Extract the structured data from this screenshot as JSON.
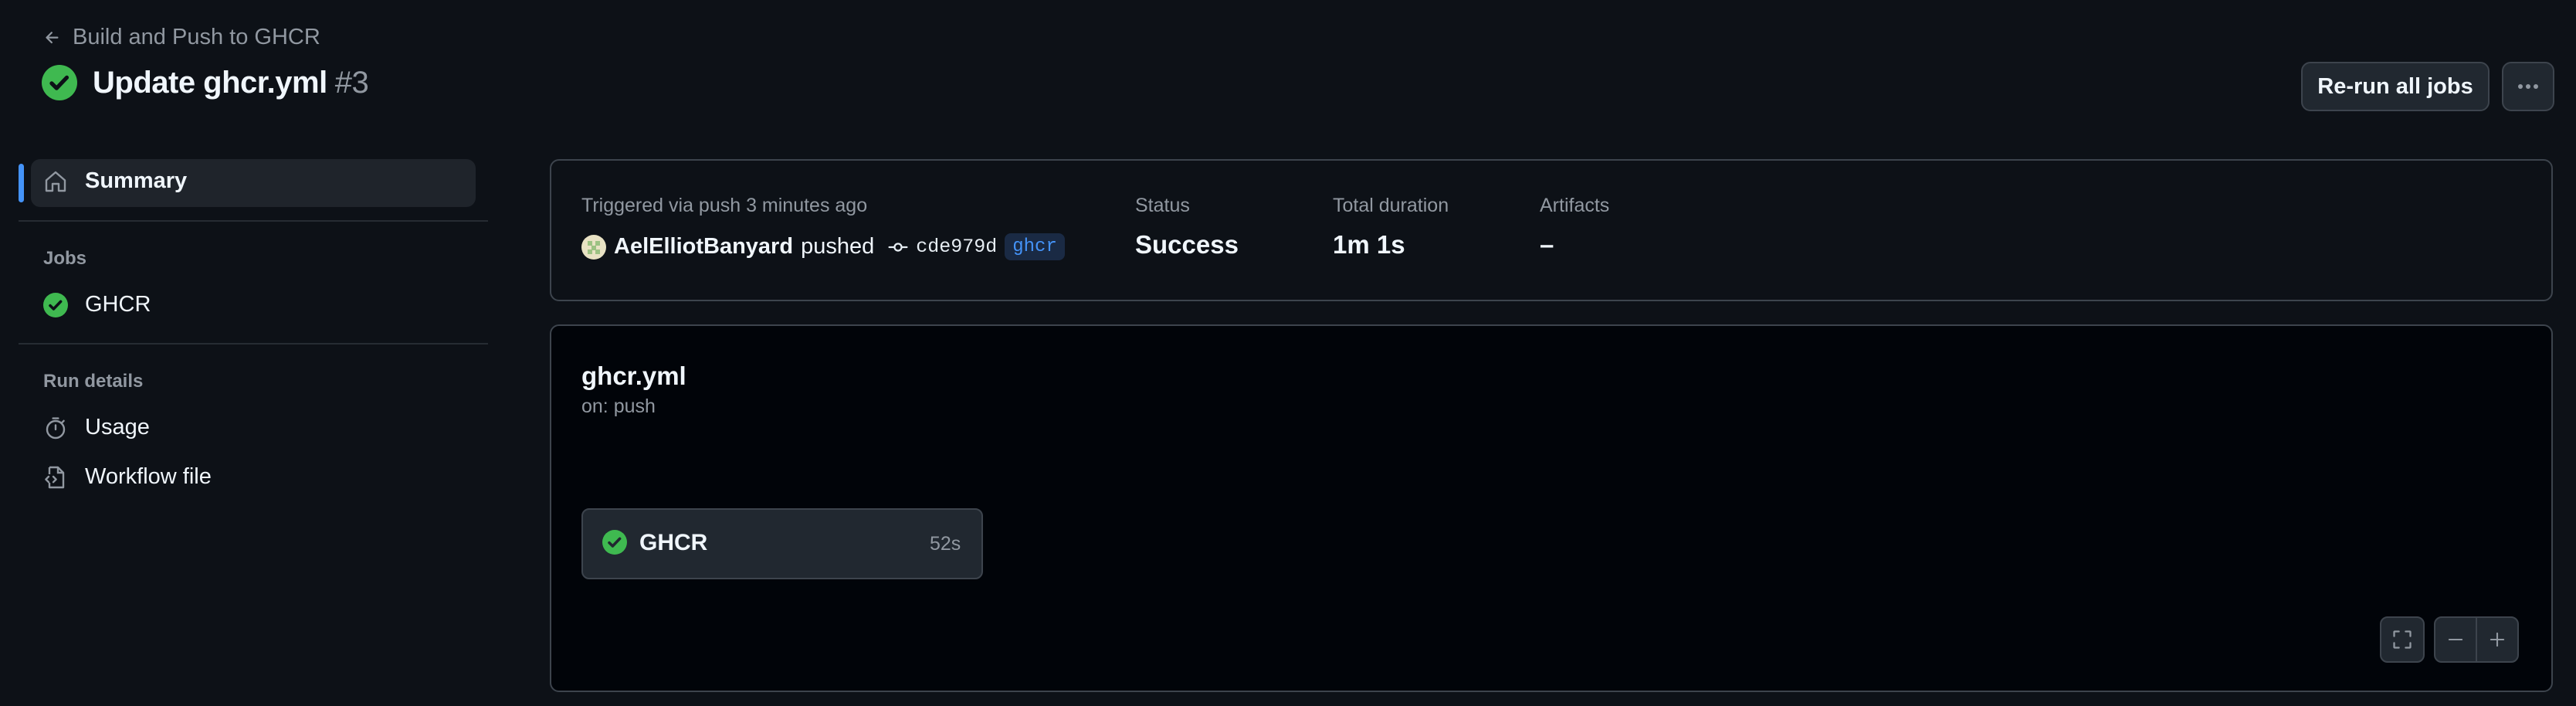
{
  "header": {
    "back_label": "Build and Push to GHCR",
    "title": "Update ghcr.yml",
    "run_number": "#3",
    "rerun_label": "Re-run all jobs"
  },
  "sidebar": {
    "summary_label": "Summary",
    "jobs_heading": "Jobs",
    "jobs": [
      {
        "label": "GHCR",
        "status": "success"
      }
    ],
    "run_details_heading": "Run details",
    "details": [
      {
        "label": "Usage",
        "icon": "stopwatch-icon"
      },
      {
        "label": "Workflow file",
        "icon": "file-code-icon"
      }
    ]
  },
  "summary": {
    "trigger_text": "Triggered via push 3 minutes ago",
    "actor": "AelElliotBanyard",
    "pushed_word": "pushed",
    "commit_sha": "cde979d",
    "branch": "ghcr",
    "status_label": "Status",
    "status_value": "Success",
    "duration_label": "Total duration",
    "duration_value": "1m 1s",
    "artifacts_label": "Artifacts",
    "artifacts_value": "–"
  },
  "graph": {
    "workflow_file": "ghcr.yml",
    "trigger": "on: push",
    "job": {
      "name": "GHCR",
      "duration": "52s",
      "status": "success"
    }
  },
  "colors": {
    "success": "#3fb950",
    "accent": "#4493f8",
    "background": "#0d1117"
  }
}
